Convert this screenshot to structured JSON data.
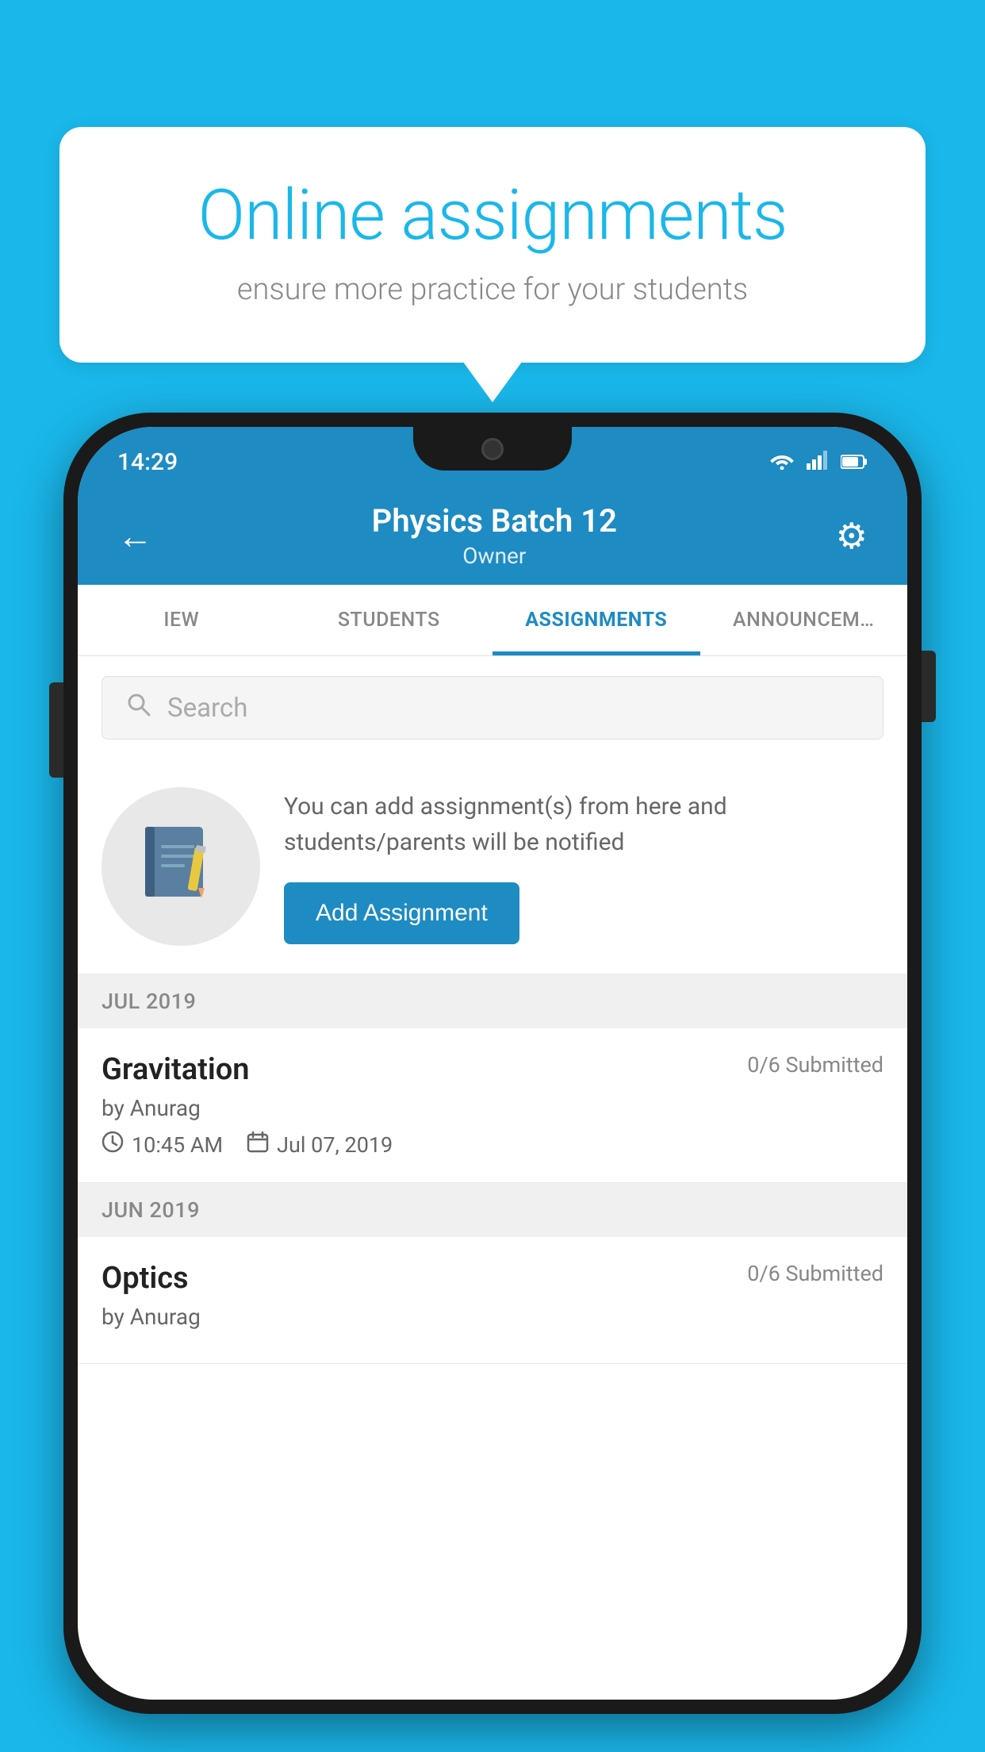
{
  "background": {
    "color": "#1ab7ea"
  },
  "speech_bubble": {
    "title": "Online assignments",
    "subtitle": "ensure more practice for your students"
  },
  "status_bar": {
    "time": "14:29",
    "wifi_icon": "wifi",
    "signal_icon": "signal",
    "battery_icon": "battery"
  },
  "header": {
    "title": "Physics Batch 12",
    "subtitle": "Owner",
    "back_label": "←",
    "settings_label": "⚙"
  },
  "tabs": [
    {
      "label": "IEW",
      "active": false
    },
    {
      "label": "STUDENTS",
      "active": false
    },
    {
      "label": "ASSIGNMENTS",
      "active": true
    },
    {
      "label": "ANNOUNCEM…",
      "active": false
    }
  ],
  "search": {
    "placeholder": "Search"
  },
  "promo": {
    "icon": "📓",
    "description": "You can add assignment(s) from here and students/parents will be notified",
    "button_label": "Add Assignment"
  },
  "sections": [
    {
      "label": "JUL 2019",
      "assignments": [
        {
          "name": "Gravitation",
          "submitted": "0/6 Submitted",
          "by": "by Anurag",
          "time": "10:45 AM",
          "date": "Jul 07, 2019"
        }
      ]
    },
    {
      "label": "JUN 2019",
      "assignments": [
        {
          "name": "Optics",
          "submitted": "0/6 Submitted",
          "by": "by Anurag",
          "time": "",
          "date": ""
        }
      ]
    }
  ]
}
